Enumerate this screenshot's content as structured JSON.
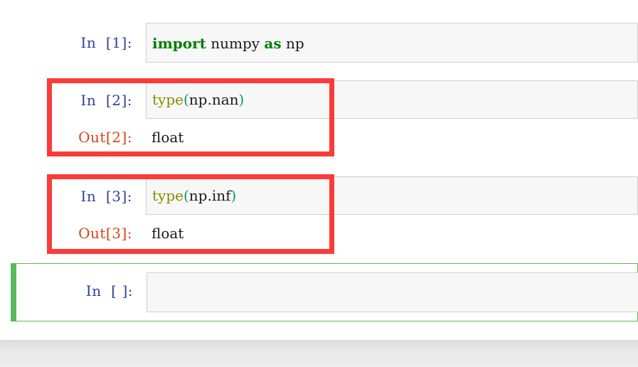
{
  "notebook": {
    "cells": [
      {
        "kind": "code",
        "prompt_in": "In  [1]:",
        "code_tokens": [
          {
            "text": "import",
            "style": "kw"
          },
          {
            "text": " ",
            "style": "plain"
          },
          {
            "text": "numpy",
            "style": "plain"
          },
          {
            "text": " ",
            "style": "plain"
          },
          {
            "text": "as",
            "style": "kw"
          },
          {
            "text": " ",
            "style": "plain"
          },
          {
            "text": "np",
            "style": "plain"
          }
        ],
        "code_text": "import numpy as np",
        "has_output": false,
        "annotated": false,
        "selected": false
      },
      {
        "kind": "code",
        "prompt_in": "In  [2]:",
        "code_tokens": [
          {
            "text": "type",
            "style": "builtin"
          },
          {
            "text": "(",
            "style": "paren"
          },
          {
            "text": "np.nan",
            "style": "plain"
          },
          {
            "text": ")",
            "style": "paren"
          }
        ],
        "code_text": "type(np.nan)",
        "has_output": true,
        "prompt_out": "Out[2]:",
        "output_text": "float",
        "annotated": true,
        "selected": false
      },
      {
        "kind": "code",
        "prompt_in": "In  [3]:",
        "code_tokens": [
          {
            "text": "type",
            "style": "builtin"
          },
          {
            "text": "(",
            "style": "paren"
          },
          {
            "text": "np.inf",
            "style": "plain"
          },
          {
            "text": ")",
            "style": "paren"
          }
        ],
        "code_text": "type(np.inf)",
        "has_output": true,
        "prompt_out": "Out[3]:",
        "output_text": "float",
        "annotated": true,
        "selected": false
      },
      {
        "kind": "code",
        "prompt_in": "In  [ ]:",
        "code_tokens": [],
        "code_text": "",
        "has_output": false,
        "annotated": false,
        "selected": true
      }
    ]
  },
  "colors": {
    "prompt_in": "#303f9f",
    "prompt_out": "#d84315",
    "keyword": "#008000",
    "builtin": "#8a8a00",
    "paren": "#00a06e",
    "code_text": "#1a1a1a",
    "input_bg": "#f7f7f7",
    "input_border": "#cfcfcf",
    "annotation_red": "#fb3b36",
    "selected_green": "#5cb85c",
    "page_bg": "#ffffff",
    "footer_bg": "#e9e9e9"
  }
}
